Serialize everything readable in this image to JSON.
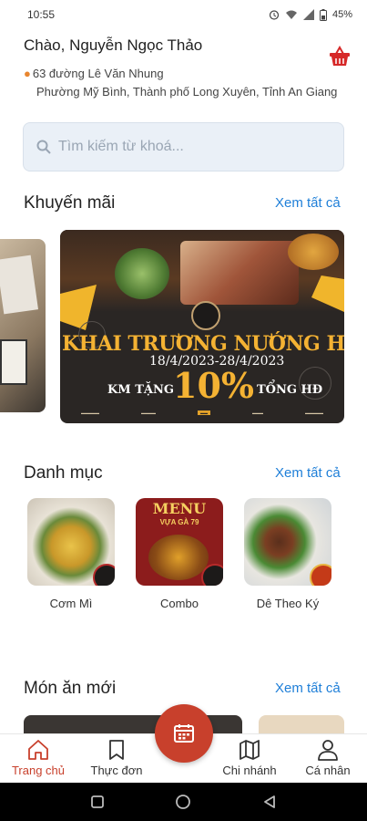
{
  "status_bar": {
    "time": "10:55",
    "battery": "45%"
  },
  "header": {
    "greeting": "Chào, Nguyễn Ngọc Thảo",
    "address_line1": "63 đường Lê Văn Nhung",
    "address_line2": "Phường Mỹ Bình, Thành phố Long Xuyên, Tỉnh An Giang",
    "cart_icon": "basket-icon"
  },
  "search": {
    "placeholder": "Tìm kiếm từ khoá...",
    "icon": "search-icon"
  },
  "promotions": {
    "title": "Khuyến mãi",
    "see_all": "Xem tất cả",
    "banner": {
      "headline": "KHAI TRƯƠNG NƯỚNG HẬU CUNG",
      "dates": "18/4/2023-28/4/2023",
      "discount_prefix": "KM TẶNG",
      "discount": "10%",
      "discount_suffix": "TỔNG HĐ"
    }
  },
  "categories": {
    "title": "Danh mục",
    "see_all": "Xem tất cả",
    "items": [
      {
        "label": "Cơm Mì"
      },
      {
        "label": "Combo",
        "menu_title": "MENU",
        "menu_subtitle": "VỰA GÀ 79"
      },
      {
        "label": "Dê Theo Ký"
      }
    ]
  },
  "new_dishes": {
    "title": "Món ăn mới",
    "see_all": "Xem tất cả"
  },
  "bottom_nav": {
    "items": [
      {
        "label": "Trang chủ",
        "icon": "home-icon",
        "active": true
      },
      {
        "label": "Thực đơn",
        "icon": "bookmark-icon",
        "active": false
      },
      {
        "label": "Chi nhánh",
        "icon": "map-icon",
        "active": false
      },
      {
        "label": "Cá nhân",
        "icon": "user-icon",
        "active": false
      }
    ],
    "center_button_icon": "calendar-icon"
  },
  "colors": {
    "accent": "#c8402c",
    "link": "#1f7fd8",
    "pin": "#e8862f"
  }
}
